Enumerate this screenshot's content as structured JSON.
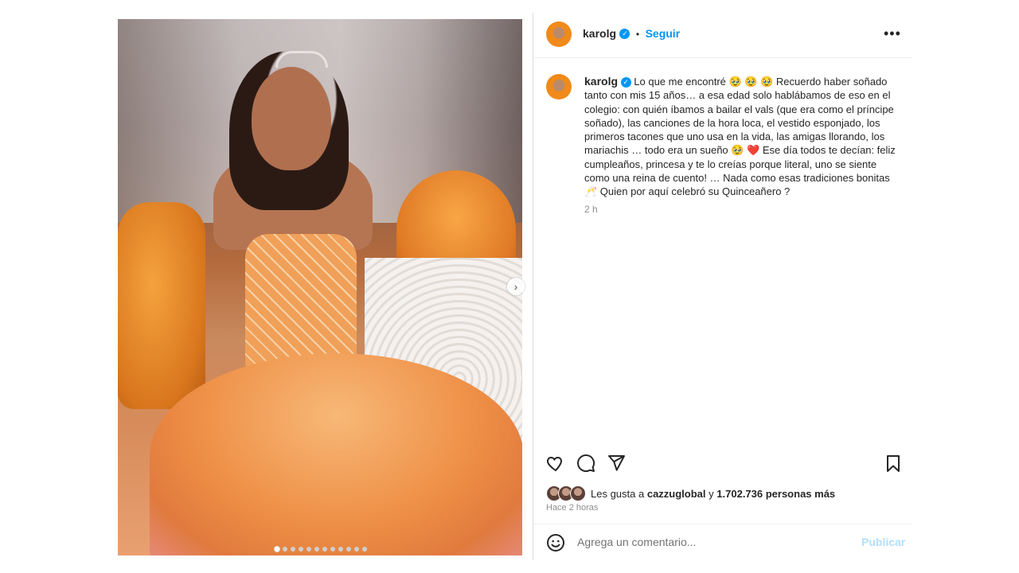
{
  "post": {
    "slide_count": 12,
    "active_slide": 1
  },
  "author": {
    "username": "karolg",
    "follow_label": "Seguir",
    "more_label": "•••"
  },
  "caption": {
    "username": "karolg",
    "text": "Lo que me encontré 🥹 🥹 🥹  Recuerdo haber soñado tanto con mis 15 años… a esa edad solo hablábamos de eso en el colegio: con quién íbamos a bailar el vals (que era como el príncipe soñado), las canciones de la hora loca, el vestido esponjado, los primeros tacones que uno usa en la vida, las amigas llorando, los mariachis … todo era un sueño 🥹 ❤️  Ese día todos te decían: feliz cumpleaños, princesa y te lo creías porque literal, uno se siente como una reina de cuento! … Nada como esas tradiciones bonitas 🥂  Quien por aquí celebró su Quinceañero ?",
    "time": "2 h"
  },
  "likes": {
    "prefix": "Les gusta a",
    "user": "cazzuglobal",
    "connector": "y",
    "count_text": "1.702.736 personas más"
  },
  "posted_ago": "Hace 2 horas",
  "comment_box": {
    "placeholder": "Agrega un comentario...",
    "publish_label": "Publicar"
  },
  "icons": {
    "like": "heart-icon",
    "comment": "comment-icon",
    "share": "send-icon",
    "save": "bookmark-icon",
    "emoji": "emoji-icon",
    "next": "chevron-right-icon"
  },
  "colors": {
    "accent": "#0095f6",
    "publish_disabled": "#b2dffc",
    "muted": "#8e8e8e"
  }
}
